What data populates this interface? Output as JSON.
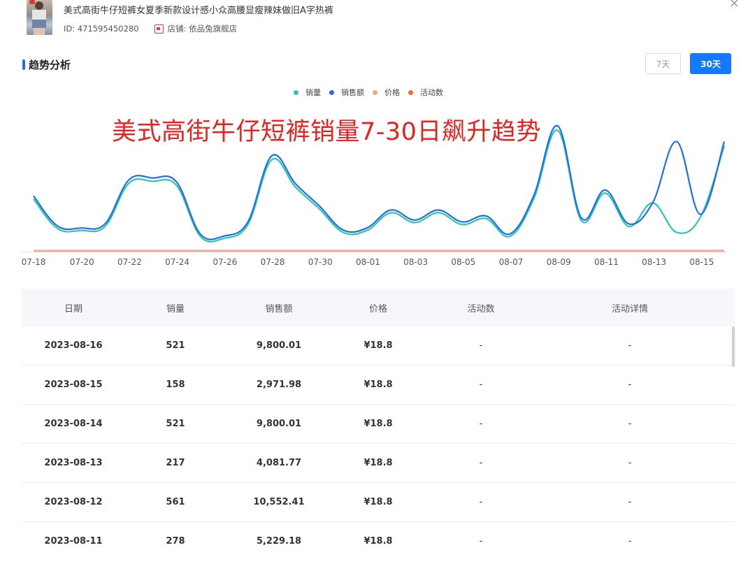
{
  "product": {
    "title": "美式高街牛仔短裤女夏季新款设计感小众高腰显瘦辣妹做旧A字热裤",
    "id_label": "ID: 471595450280",
    "shop_label": "店铺: 依品兔旗舰店"
  },
  "window": {
    "close_glyph": "×"
  },
  "section": {
    "title": "趋势分析",
    "btn_7": "7天",
    "btn_30": "30天"
  },
  "overlay_title": "美式高街牛仔短裤销量7-30日飙升趋势",
  "colors": {
    "sales_qty": "#2ec4b6",
    "sales_amount": "#1f6fe5",
    "price": "#f6a38a",
    "activity": "#f26b2a",
    "primary": "#1677ff",
    "overlay": "#e8231f"
  },
  "chart_data": {
    "type": "line",
    "x": [
      "07-18",
      "07-19",
      "07-20",
      "07-21",
      "07-22",
      "07-23",
      "07-24",
      "07-25",
      "07-26",
      "07-27",
      "07-28",
      "07-29",
      "07-30",
      "07-31",
      "08-01",
      "08-02",
      "08-03",
      "08-04",
      "08-05",
      "08-06",
      "08-07",
      "08-08",
      "08-09",
      "08-10",
      "08-11",
      "08-12",
      "08-13",
      "08-14",
      "08-15",
      "08-16"
    ],
    "tick_labels": [
      "07-18",
      "07-20",
      "07-22",
      "07-24",
      "07-26",
      "07-28",
      "07-30",
      "08-01",
      "08-03",
      "08-05",
      "08-07",
      "08-09",
      "08-11",
      "08-13",
      "08-15"
    ],
    "series": [
      {
        "name": "销量",
        "values": [
          250,
          100,
          90,
          110,
          330,
          340,
          320,
          60,
          50,
          120,
          450,
          310,
          200,
          80,
          90,
          180,
          130,
          180,
          120,
          150,
          60,
          250,
          600,
          140,
          280,
          110,
          230,
          80,
          158,
          521
        ]
      },
      {
        "name": "销售额",
        "values": [
          4700,
          1880,
          1690,
          2070,
          6200,
          6390,
          6020,
          1130,
          940,
          2260,
          8460,
          5830,
          3760,
          1500,
          1690,
          3380,
          2440,
          3380,
          2260,
          2820,
          1130,
          4700,
          11280,
          2630,
          5260,
          2070,
          4081.77,
          9800.01,
          2971.98,
          9800.01
        ]
      },
      {
        "name": "价格",
        "values": [
          18.8,
          18.8,
          18.8,
          18.8,
          18.8,
          18.8,
          18.8,
          18.8,
          18.8,
          18.8,
          18.8,
          18.8,
          18.8,
          18.8,
          18.8,
          18.8,
          18.8,
          18.8,
          18.8,
          18.8,
          18.8,
          18.8,
          18.8,
          18.8,
          18.8,
          18.8,
          18.8,
          18.8,
          18.8,
          18.8
        ]
      },
      {
        "name": "活动数",
        "values": [
          0,
          0,
          0,
          0,
          0,
          0,
          0,
          0,
          0,
          0,
          0,
          0,
          0,
          0,
          0,
          0,
          0,
          0,
          0,
          0,
          0,
          0,
          0,
          0,
          0,
          0,
          0,
          0,
          0,
          0
        ]
      }
    ],
    "grid": false,
    "legend": "top-center"
  },
  "table": {
    "headers": [
      "日期",
      "销量",
      "销售额",
      "价格",
      "活动数",
      "活动详情"
    ],
    "rows": [
      [
        "2023-08-16",
        "521",
        "9,800.01",
        "¥18.8",
        "-",
        "-"
      ],
      [
        "2023-08-15",
        "158",
        "2,971.98",
        "¥18.8",
        "-",
        "-"
      ],
      [
        "2023-08-14",
        "521",
        "9,800.01",
        "¥18.8",
        "-",
        "-"
      ],
      [
        "2023-08-13",
        "217",
        "4,081.77",
        "¥18.8",
        "-",
        "-"
      ],
      [
        "2023-08-12",
        "561",
        "10,552.41",
        "¥18.8",
        "-",
        "-"
      ],
      [
        "2023-08-11",
        "278",
        "5,229.18",
        "¥18.8",
        "-",
        "-"
      ]
    ]
  }
}
